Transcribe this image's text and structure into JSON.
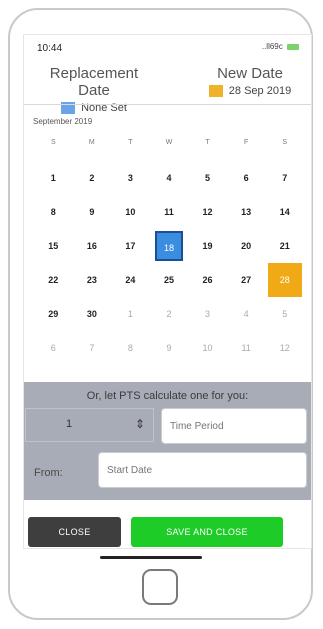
{
  "status": {
    "time": "10:44",
    "signal": "..ll69c"
  },
  "header": {
    "replacement": {
      "title": "Replacement Date",
      "value": "None Set",
      "color": "#6aa3e8"
    },
    "new_date": {
      "title": "New Date",
      "value": "28 Sep 2019",
      "color": "#f0b12b"
    }
  },
  "calendar": {
    "month_label": "September 2019",
    "weekdays": [
      "S",
      "M",
      "T",
      "W",
      "T",
      "F",
      "S"
    ],
    "days": [
      [
        "1",
        "2",
        "3",
        "4",
        "5",
        "6",
        "7"
      ],
      [
        "8",
        "9",
        "10",
        "11",
        "12",
        "13",
        "14"
      ],
      [
        "15",
        "16",
        "17",
        "18",
        "19",
        "20",
        "21"
      ],
      [
        "22",
        "23",
        "24",
        "25",
        "26",
        "27",
        "28"
      ],
      [
        "29",
        "30",
        "1",
        "2",
        "3",
        "4",
        "5"
      ],
      [
        "6",
        "7",
        "8",
        "9",
        "10",
        "11",
        "12"
      ]
    ],
    "selected_day": "18",
    "new_day": "28"
  },
  "calculator": {
    "heading": "Or, let PTS calculate one for you:",
    "quantity": "1",
    "time_period_placeholder": "Time Period",
    "from_label": "From:",
    "start_date_placeholder": "Start Date"
  },
  "actions": {
    "close_label": "CLOSE",
    "save_label": "SAVE AND CLOSE"
  }
}
